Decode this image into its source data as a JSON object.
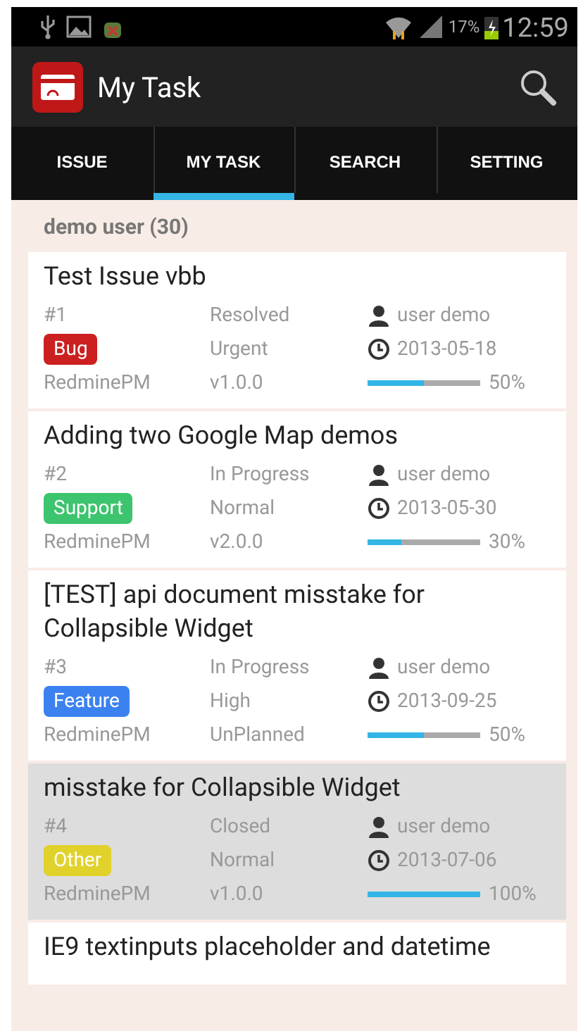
{
  "status_bar": {
    "battery": "17%",
    "time": "12:59"
  },
  "app_bar": {
    "title": "My Task"
  },
  "tabs": [
    {
      "label": "ISSUE",
      "selected": false
    },
    {
      "label": "MY TASK",
      "selected": true
    },
    {
      "label": "SEARCH",
      "selected": false
    },
    {
      "label": "SETTING",
      "selected": false
    }
  ],
  "list_header": "demo user (30)",
  "issues": [
    {
      "title": "Test Issue vbb",
      "number": "#1",
      "status": "Resolved",
      "assignee": "user demo",
      "tracker": "Bug",
      "color": "#cc1f1f",
      "priority": "Urgent",
      "due_date": "2013-05-18",
      "project": "RedminePM",
      "version": "v1.0.0",
      "level": 0.5,
      "percent": "50%",
      "selected": false
    },
    {
      "title": "Adding two Google Map demos",
      "number": "#2",
      "status": "In Progress",
      "assignee": "user demo",
      "tracker": "Support",
      "color": "#3cc46e",
      "priority": "Normal",
      "due_date": "2013-05-30",
      "project": "RedminePM",
      "version": "v2.0.0",
      "level": 0.3,
      "percent": "30%",
      "selected": false
    },
    {
      "title": "[TEST] api document misstake for Collapsible Widget",
      "number": "#3",
      "status": "In Progress",
      "assignee": "user demo",
      "tracker": "Feature",
      "color": "#3b82f0",
      "priority": "High",
      "due_date": "2013-09-25",
      "project": "RedminePM",
      "version": "UnPlanned",
      "level": 0.5,
      "percent": "50%",
      "selected": false
    },
    {
      "title": "misstake for Collapsible Widget",
      "number": "#4",
      "status": "Closed",
      "assignee": "user demo",
      "tracker": "Other",
      "color": "#e0d22a",
      "priority": "Normal",
      "due_date": "2013-07-06",
      "project": "RedminePM",
      "version": "v1.0.0",
      "level": 1,
      "percent": "100%",
      "selected": true
    },
    {
      "title": "IE9 textinputs placeholder and datetime",
      "selected": false
    }
  ]
}
